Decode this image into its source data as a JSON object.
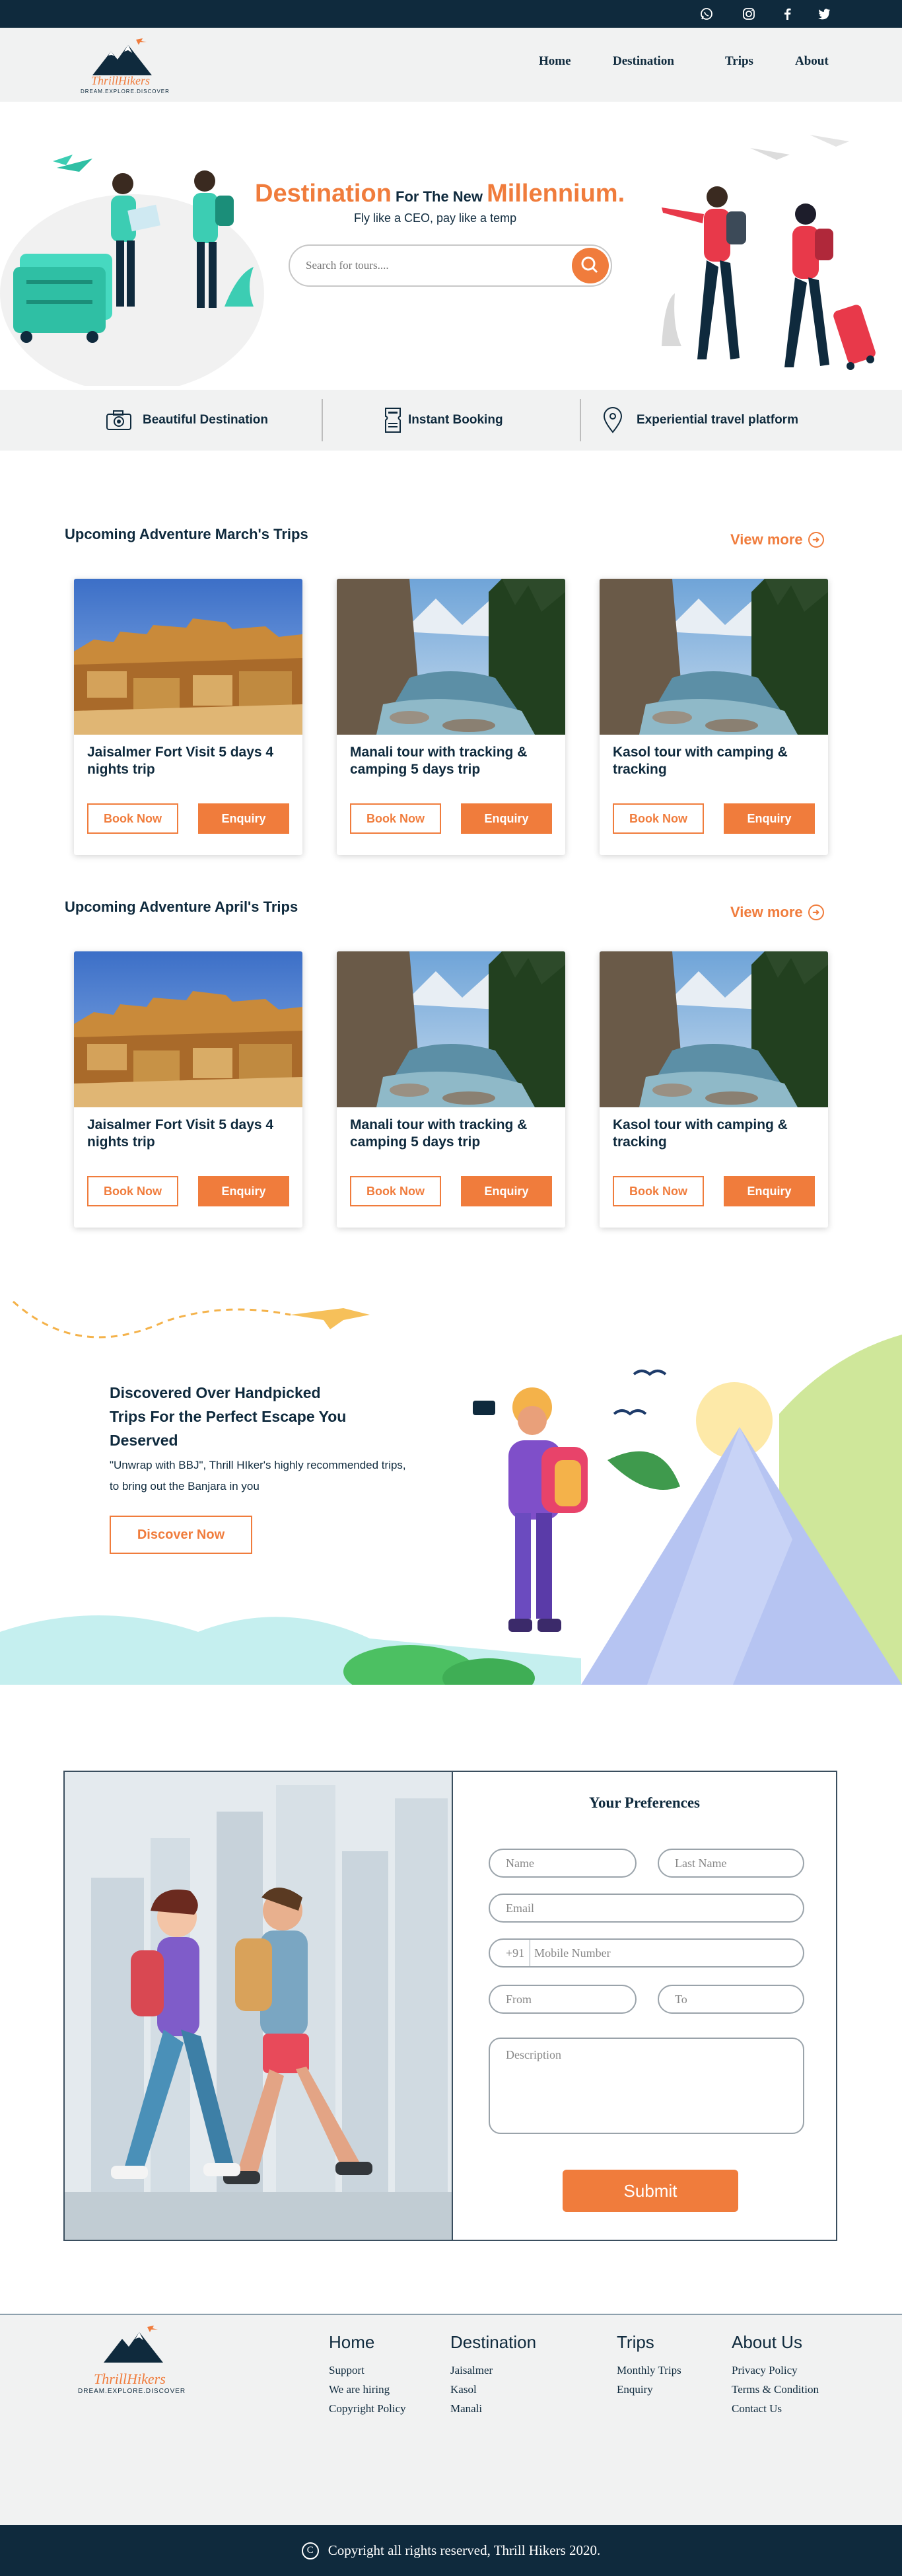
{
  "social": [
    "whatsapp-icon",
    "instagram-icon",
    "facebook-icon",
    "twitter-icon"
  ],
  "brand": {
    "name": "ThrillHikers",
    "tagline": "DREAM.EXPLORE.DISCOVER",
    "accent": "#f07c3c",
    "navy": "#0f2a3d"
  },
  "nav": {
    "items": [
      "Home",
      "Destination",
      "Trips",
      "About"
    ]
  },
  "hero": {
    "title_part1": "Destination",
    "title_part2": " For The New ",
    "title_part3": "Millennium.",
    "subtitle": "Fly like a CEO, pay like a temp",
    "search_placeholder": "Search for tours...."
  },
  "features": [
    {
      "icon": "camera-icon",
      "label": "Beautiful Destination"
    },
    {
      "icon": "ticket-icon",
      "label": "Instant Booking"
    },
    {
      "icon": "location-pin-icon",
      "label": "Experiential travel platform"
    }
  ],
  "sections": [
    {
      "title": "Upcoming Adventure March's Trips",
      "view_more": "View more",
      "cards": [
        {
          "image": "fort",
          "title": "Jaisalmer Fort Visit 5 days 4 nights trip",
          "book": "Book Now",
          "enquiry": "Enquiry"
        },
        {
          "image": "river",
          "title": "Manali tour with tracking & camping 5 days trip",
          "book": "Book Now",
          "enquiry": "Enquiry"
        },
        {
          "image": "river",
          "title": "Kasol tour with camping & tracking",
          "book": "Book Now",
          "enquiry": "Enquiry"
        }
      ]
    },
    {
      "title": "Upcoming Adventure April's Trips",
      "view_more": "View more",
      "cards": [
        {
          "image": "fort",
          "title": "Jaisalmer Fort Visit 5 days 4 nights trip",
          "book": "Book Now",
          "enquiry": "Enquiry"
        },
        {
          "image": "river",
          "title": "Manali tour with tracking & camping 5 days trip",
          "book": "Book Now",
          "enquiry": "Enquiry"
        },
        {
          "image": "river",
          "title": "Kasol tour with camping & tracking",
          "book": "Book Now",
          "enquiry": "Enquiry"
        }
      ]
    }
  ],
  "discover": {
    "heading": "Discovered Over Handpicked Trips For the Perfect Escape You Deserved",
    "text": "\"Unwrap with BBJ\", Thrill HIker's highly recommended trips, to bring out the Banjara in you",
    "button": "Discover Now"
  },
  "form": {
    "title": "Your Preferences",
    "name": "Name",
    "last_name": "Last Name",
    "email": "Email",
    "country_code": "+91",
    "mobile": "Mobile Number",
    "from": "From",
    "to": "To",
    "description": "Description",
    "submit": "Submit"
  },
  "footer": {
    "columns": [
      {
        "title": "Home",
        "links": [
          "Support",
          "We are hiring",
          "Copyright Policy"
        ]
      },
      {
        "title": "Destination",
        "links": [
          "Jaisalmer",
          "Kasol",
          "Manali"
        ]
      },
      {
        "title": "Trips",
        "links": [
          "Monthly Trips",
          "Enquiry"
        ]
      },
      {
        "title": "About Us",
        "links": [
          "Privacy Policy",
          "Terms & Condition",
          "Contact Us"
        ]
      }
    ],
    "copyright": "Copyright all rights reserved, Thrill Hikers 2020."
  }
}
